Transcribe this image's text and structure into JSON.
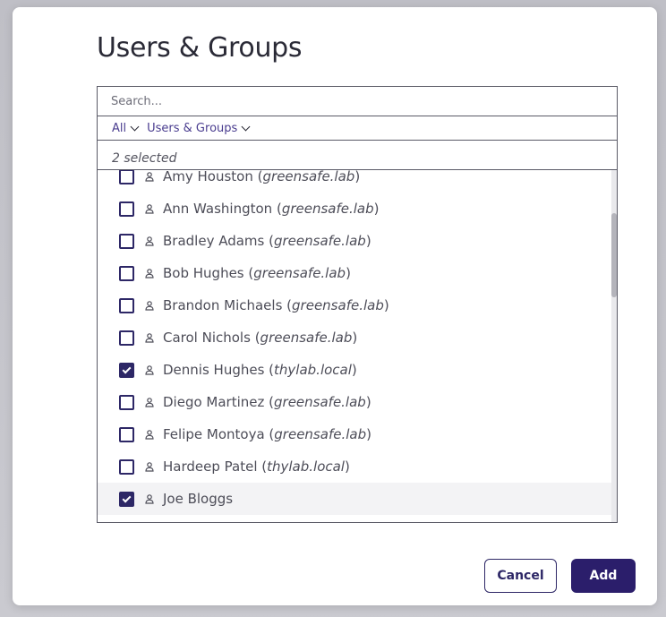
{
  "dialog": {
    "title": "Users & Groups",
    "search": {
      "placeholder": "Search...",
      "value": ""
    },
    "filters": {
      "scope": "All",
      "type": "Users & Groups"
    },
    "selected_count_text": "2 selected",
    "items": [
      {
        "name": "Amy Houston",
        "domain": "greensafe.lab",
        "checked": false,
        "icon": "user-icon"
      },
      {
        "name": "Ann Washington",
        "domain": "greensafe.lab",
        "checked": false,
        "icon": "user-icon"
      },
      {
        "name": "Bradley Adams",
        "domain": "greensafe.lab",
        "checked": false,
        "icon": "user-icon"
      },
      {
        "name": "Bob Hughes",
        "domain": "greensafe.lab",
        "checked": false,
        "icon": "user-icon"
      },
      {
        "name": "Brandon Michaels",
        "domain": "greensafe.lab",
        "checked": false,
        "icon": "user-icon"
      },
      {
        "name": "Carol Nichols",
        "domain": "greensafe.lab",
        "checked": false,
        "icon": "user-icon"
      },
      {
        "name": "Dennis Hughes",
        "domain": "thylab.local",
        "checked": true,
        "icon": "user-icon"
      },
      {
        "name": "Diego Martinez",
        "domain": "greensafe.lab",
        "checked": false,
        "icon": "user-icon"
      },
      {
        "name": "Felipe Montoya",
        "domain": "greensafe.lab",
        "checked": false,
        "icon": "user-icon"
      },
      {
        "name": "Hardeep Patel",
        "domain": "thylab.local",
        "checked": false,
        "icon": "user-icon"
      },
      {
        "name": "Joe Bloggs",
        "domain": "",
        "checked": true,
        "icon": "user-icon",
        "hovered": true
      }
    ],
    "buttons": {
      "cancel": "Cancel",
      "add": "Add"
    },
    "colors": {
      "accent": "#2b1e6b",
      "checkbox": "#2d2766",
      "filter_text": "#4a3d8f"
    }
  }
}
